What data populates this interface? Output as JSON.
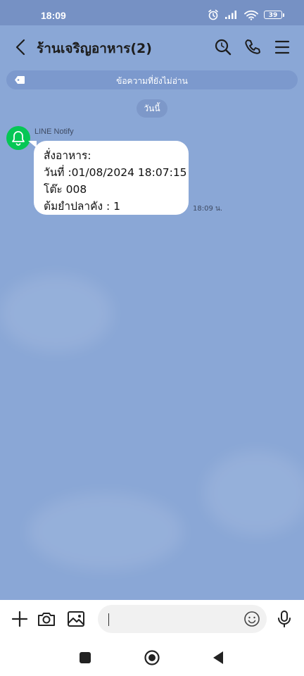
{
  "status_bar": {
    "time": "18:09",
    "battery": "39"
  },
  "header": {
    "title": "ร้านเจริญอาหาร(2)"
  },
  "unread_bar": {
    "text": "ข้อความที่ยังไม่อ่าน"
  },
  "date_chip": "วันนี้",
  "message": {
    "sender": "LINE Notify",
    "lines": [
      "สั่งอาหาร:",
      "วันที่ :01/08/2024 18:07:15",
      "โต๊ะ 008",
      "ต้มยำปลาคัง : 1"
    ],
    "time": "18:09 น."
  },
  "input": {
    "value": "",
    "placeholder": ""
  },
  "colors": {
    "background": "#8aa7d6",
    "status_bar": "#7691c4",
    "avatar": "#06c755"
  },
  "icons": {
    "back": "chevron-left-icon",
    "search": "search-icon",
    "call": "phone-icon",
    "menu": "menu-icon",
    "plus": "plus-icon",
    "camera": "camera-icon",
    "image": "image-icon",
    "emoji": "emoji-icon",
    "mic": "microphone-icon",
    "avatar": "bell-icon"
  }
}
